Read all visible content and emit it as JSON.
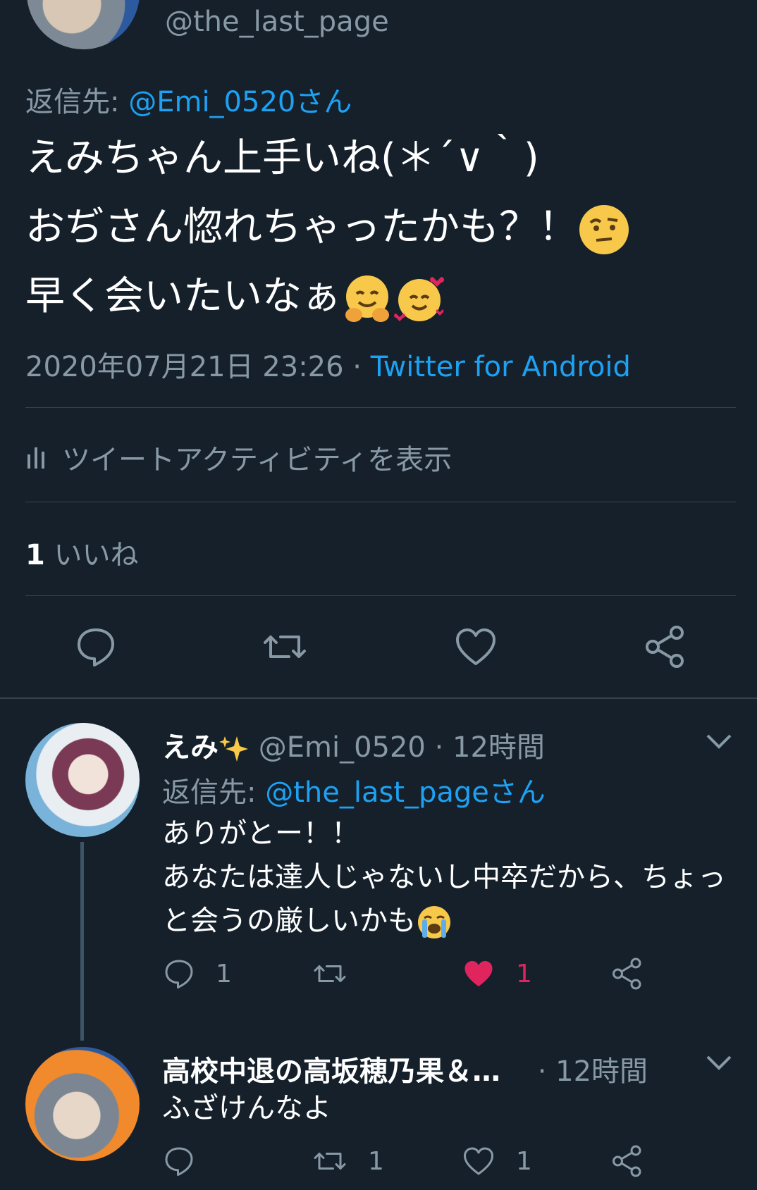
{
  "main_tweet": {
    "handle": "@the_last_page",
    "reply_prefix": "返信先: ",
    "reply_to": "@Emi_0520さん",
    "lines": [
      "えみちゃん上手いね(＊´∨｀)",
      "おぢさん惚れちゃったかも？！",
      "早く会いたいなぁ"
    ],
    "timestamp": "2020年07月21日 23:26",
    "separator": " · ",
    "client": "Twitter for Android",
    "activity_label": "ツイートアクティビティを表示",
    "likes_count": "1",
    "likes_label": " いいね"
  },
  "reply1": {
    "name": "えみ",
    "handle": " @Emi_0520",
    "time": " · 12時間",
    "reply_prefix": "返信先: ",
    "reply_to": "@the_last_pageさん",
    "line1": "ありがとー！！",
    "line2": "あなたは達人じゃないし中卒だから、ちょっと会うの厳しいかも",
    "reply_count": "1",
    "like_count": "1"
  },
  "reply2": {
    "name": "高校中退の高坂穂乃果＆…",
    "time": " · 12時間",
    "text": "ふざけんなよ",
    "retweet_count": "1",
    "like_count": "1"
  },
  "colors": {
    "background": "#15202b",
    "muted": "#8899a6",
    "link": "#1da1f2",
    "like": "#e0245e",
    "divider": "#38444d"
  },
  "icons": [
    "reply-icon",
    "retweet-icon",
    "like-icon",
    "share-icon",
    "chevron-down-icon",
    "activity-bars-icon"
  ]
}
